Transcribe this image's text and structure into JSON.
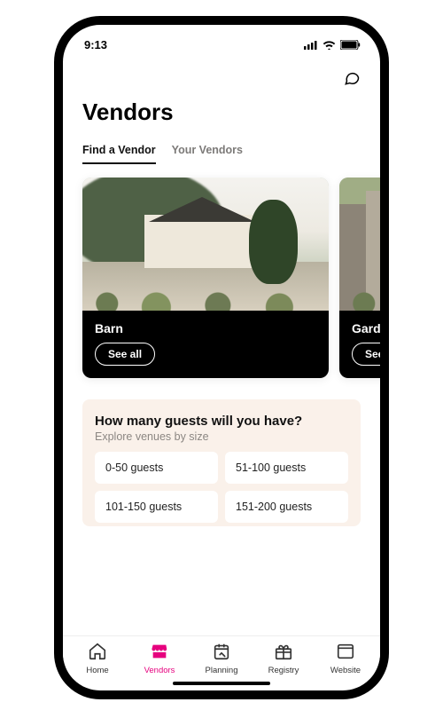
{
  "status": {
    "time": "9:13"
  },
  "header": {
    "title": "Vendors"
  },
  "tabs": [
    {
      "label": "Find a Vendor",
      "active": true
    },
    {
      "label": "Your Vendors",
      "active": false
    }
  ],
  "cards": [
    {
      "title": "Barn",
      "cta": "See all"
    },
    {
      "title": "Garden",
      "cta": "See all"
    }
  ],
  "guest_panel": {
    "title": "How many guests will you have?",
    "subtitle": "Explore venues by size",
    "options": [
      "0-50 guests",
      "51-100 guests",
      "101-150 guests",
      "151-200 guests"
    ]
  },
  "nav": [
    {
      "label": "Home"
    },
    {
      "label": "Vendors"
    },
    {
      "label": "Planning"
    },
    {
      "label": "Registry"
    },
    {
      "label": "Website"
    }
  ]
}
